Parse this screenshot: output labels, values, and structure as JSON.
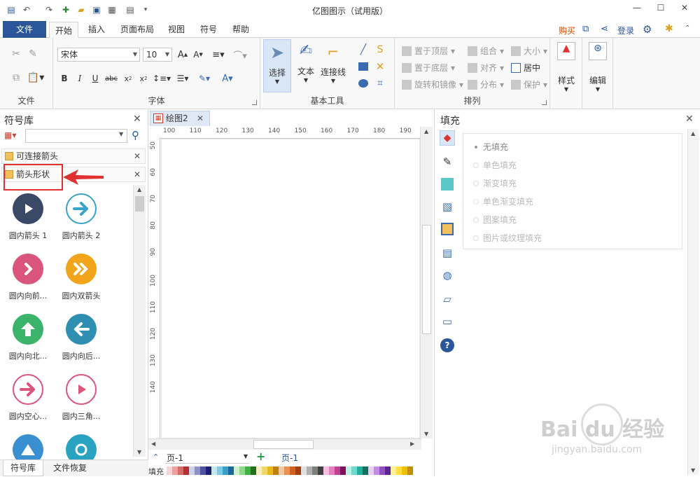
{
  "app": {
    "title": "亿图图示（试用版）"
  },
  "menu_tabs": [
    "文件",
    "开始",
    "插入",
    "页面布局",
    "视图",
    "符号",
    "帮助"
  ],
  "header_right": {
    "buy": "购买",
    "login": "登录"
  },
  "ribbon": {
    "clipboard_label": "文件",
    "font": {
      "name": "宋体",
      "size": "10",
      "label": "字体"
    },
    "basic_tools": {
      "select": "选择",
      "text": "文本",
      "connector": "连接线",
      "label": "基本工具"
    },
    "arrange": {
      "items": [
        "置于顶层",
        "组合",
        "大小",
        "置于底层",
        "对齐",
        "居中",
        "旋转和镜像",
        "分布",
        "保护"
      ],
      "label": "排列"
    },
    "style": "样式",
    "edit": "编辑"
  },
  "left_panel": {
    "title": "符号库",
    "search_placeholder": "",
    "libraries": [
      "可连接箭头",
      "箭头形状"
    ],
    "shapes": [
      {
        "label": "圆内箭头 1",
        "color": "#3a4a66",
        "icon": "play"
      },
      {
        "label": "圆内箭头 2",
        "color": "#3aa3c8",
        "icon": "arrow-right-outline"
      },
      {
        "label": "圆内向前...",
        "color": "#d9557e",
        "icon": "chevron-right"
      },
      {
        "label": "圆内双箭头",
        "color": "#f0a51b",
        "icon": "double-chevron"
      },
      {
        "label": "圆内向北...",
        "color": "#3bb36a",
        "icon": "arrow-up"
      },
      {
        "label": "圆内向后...",
        "color": "#2f8fb0",
        "icon": "arrow-left"
      },
      {
        "label": "圆内空心...",
        "color": "#d9557e",
        "icon": "arrow-right-outline"
      },
      {
        "label": "圆内三角...",
        "color": "#d9557e",
        "icon": "play-outline"
      },
      {
        "label": "",
        "color": "#3a8fd0",
        "icon": "triangle-up"
      },
      {
        "label": "",
        "color": "#2aa3c0",
        "icon": "refresh"
      }
    ],
    "bottom_tabs": [
      "符号库",
      "文件恢复"
    ]
  },
  "canvas": {
    "doc_tab": "绘图2",
    "ruler_h": [
      "100",
      "110",
      "120",
      "130",
      "140",
      "150",
      "160",
      "170",
      "180",
      "190"
    ],
    "ruler_v": [
      "50",
      "60",
      "70",
      "80",
      "90",
      "100",
      "110",
      "120",
      "130",
      "140"
    ],
    "page_select": "页-1",
    "page_tab": "页-1",
    "fill_label": "填充"
  },
  "right_panel": {
    "title": "填充",
    "options": [
      "无填充",
      "单色填充",
      "渐变填充",
      "单色渐变填充",
      "图案填充",
      "图片或纹理填充"
    ]
  },
  "watermark": {
    "brand": "Bai du 经验",
    "url": "jingyan.baidu.com"
  }
}
